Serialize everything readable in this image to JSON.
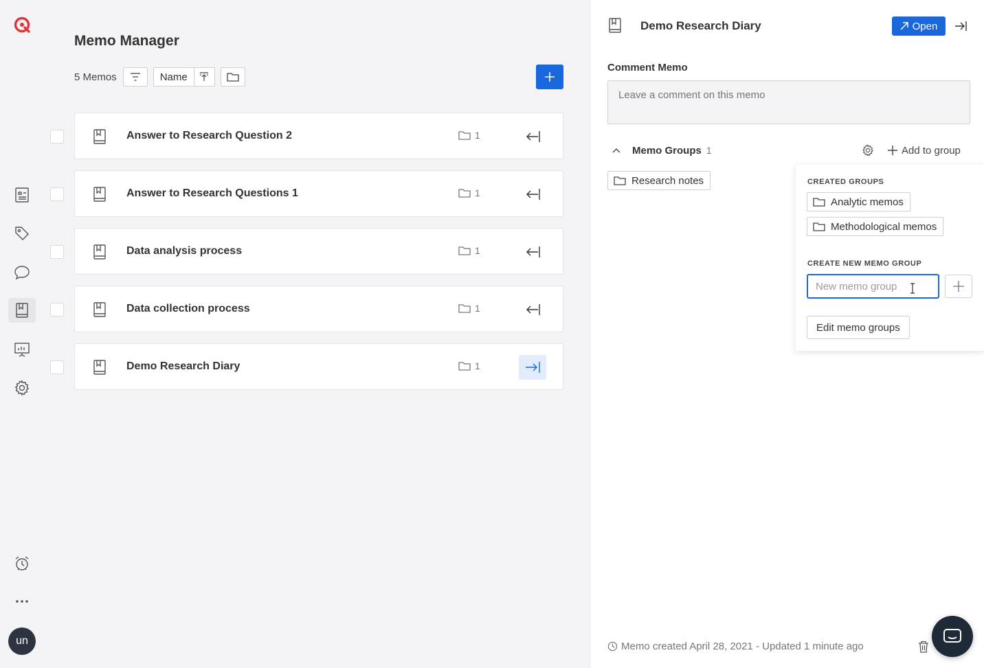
{
  "app": {
    "brand_color": "#e5333a",
    "accent_color": "#1a66db"
  },
  "rail": {
    "items": [
      {
        "icon": "document-icon"
      },
      {
        "icon": "tag-icon"
      },
      {
        "icon": "comment-icon"
      },
      {
        "icon": "memo-icon",
        "active": true
      },
      {
        "icon": "presentation-icon"
      },
      {
        "icon": "gear-icon"
      }
    ],
    "bottom": [
      {
        "icon": "alarm-clock-icon"
      },
      {
        "icon": "more-icon"
      }
    ],
    "avatar_initials": "un"
  },
  "memo_manager": {
    "title": "Memo Manager",
    "count_label": "5 Memos",
    "sort_label": "Name",
    "memos": [
      {
        "title": "Answer to Research Question 2",
        "folder_count": "1",
        "active": false
      },
      {
        "title": "Answer to Research Questions 1",
        "folder_count": "1",
        "active": false
      },
      {
        "title": "Data analysis process",
        "folder_count": "1",
        "active": false
      },
      {
        "title": "Data collection process",
        "folder_count": "1",
        "active": false
      },
      {
        "title": "Demo Research Diary",
        "folder_count": "1",
        "active": true
      }
    ]
  },
  "panel": {
    "title": "Demo Research Diary",
    "open_label": "Open",
    "comment_section_label": "Comment Memo",
    "comment_placeholder": "Leave a comment on this memo",
    "memo_groups_label": "Memo Groups",
    "memo_groups_count": "1",
    "add_to_group_label": "Add to group",
    "assigned_groups": [
      "Research notes"
    ],
    "footer_meta": "Memo created April 28, 2021 - Updated 1 minute ago"
  },
  "group_popover": {
    "created_groups_label": "CREATED GROUPS",
    "created_groups": [
      "Analytic memos",
      "Methodological memos"
    ],
    "create_new_label": "CREATE NEW MEMO GROUP",
    "new_group_placeholder": "New memo group",
    "new_group_value": "",
    "edit_groups_label": "Edit memo groups"
  }
}
